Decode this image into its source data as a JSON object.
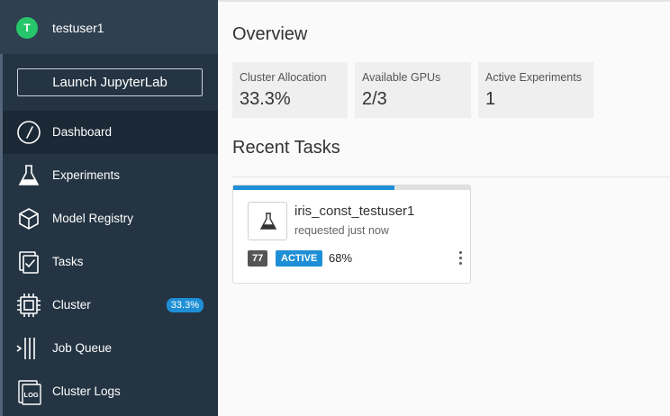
{
  "user": {
    "initial": "T",
    "name": "testuser1"
  },
  "sidebar": {
    "launch_button": "Launch JupyterLab",
    "items": [
      {
        "label": "Dashboard",
        "icon": "gauge-icon",
        "active": true
      },
      {
        "label": "Experiments",
        "icon": "flask-icon"
      },
      {
        "label": "Model Registry",
        "icon": "cube-icon"
      },
      {
        "label": "Tasks",
        "icon": "tasks-icon"
      },
      {
        "label": "Cluster",
        "icon": "chip-icon",
        "badge": "33.3%"
      },
      {
        "label": "Job Queue",
        "icon": "queue-icon"
      },
      {
        "label": "Cluster Logs",
        "icon": "log-icon"
      }
    ]
  },
  "overview": {
    "title": "Overview",
    "stats": [
      {
        "label": "Cluster Allocation",
        "value": "33.3%"
      },
      {
        "label": "Available GPUs",
        "value": "2/3"
      },
      {
        "label": "Active Experiments",
        "value": "1"
      }
    ]
  },
  "recent_tasks": {
    "title": "Recent Tasks",
    "tasks": [
      {
        "name": "iris_const_testuser1",
        "subtitle": "requested just now",
        "id": "77",
        "state": "ACTIVE",
        "progress_label": "68%",
        "progress": 0.68,
        "icon": "flask-icon"
      }
    ]
  },
  "colors": {
    "sidebar_bg": "#243443",
    "accent": "#1e8fd6",
    "avatar": "#27c66a"
  }
}
